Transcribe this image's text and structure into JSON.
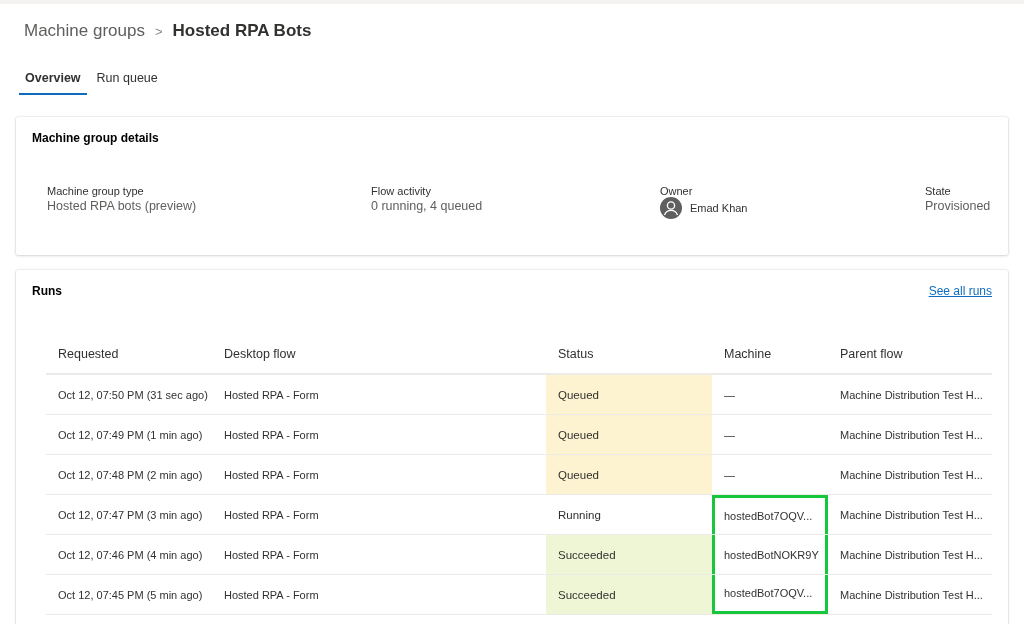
{
  "breadcrumb": {
    "parent": "Machine groups",
    "separator": ">",
    "current": "Hosted RPA Bots"
  },
  "tabs": [
    {
      "label": "Overview",
      "selected": true
    },
    {
      "label": "Run queue",
      "selected": false
    }
  ],
  "details": {
    "title": "Machine group details",
    "fields": [
      {
        "kind": "text",
        "label": "Machine group type",
        "value": "Hosted RPA bots (preview)"
      },
      {
        "kind": "text",
        "label": "Flow activity",
        "value": "0 running, 4 queued"
      },
      {
        "kind": "person",
        "label": "Owner",
        "value": "Emad Khan"
      },
      {
        "kind": "text",
        "label": "State",
        "value": "Provisioned"
      }
    ]
  },
  "runs": {
    "title": "Runs",
    "link": "See all runs",
    "columns": [
      "Requested",
      "Desktop flow",
      "Status",
      "Machine",
      "Parent flow"
    ],
    "rows": [
      {
        "requested": "Oct 12, 07:50 PM (31 sec ago)",
        "desktop_flow": "Hosted RPA - Form",
        "status": {
          "kind": "queued",
          "label": "Queued"
        },
        "machine": "—",
        "machine_highlighted": false,
        "parent_flow": "Machine Distribution Test H..."
      },
      {
        "requested": "Oct 12, 07:49 PM (1 min ago)",
        "desktop_flow": "Hosted RPA - Form",
        "status": {
          "kind": "queued",
          "label": "Queued"
        },
        "machine": "—",
        "machine_highlighted": false,
        "parent_flow": "Machine Distribution Test H..."
      },
      {
        "requested": "Oct 12, 07:48 PM (2 min ago)",
        "desktop_flow": "Hosted RPA - Form",
        "status": {
          "kind": "queued",
          "label": "Queued"
        },
        "machine": "—",
        "machine_highlighted": false,
        "parent_flow": "Machine Distribution Test H..."
      },
      {
        "requested": "Oct 12, 07:47 PM (3 min ago)",
        "desktop_flow": "Hosted RPA - Form",
        "status": {
          "kind": "running",
          "label": "Running"
        },
        "machine": "hostedBot7OQV...",
        "machine_highlighted": true,
        "parent_flow": "Machine Distribution Test H..."
      },
      {
        "requested": "Oct 12, 07:46 PM (4 min ago)",
        "desktop_flow": "Hosted RPA - Form",
        "status": {
          "kind": "succeeded",
          "label": "Succeeded"
        },
        "machine": "hostedBotNOKR9Y",
        "machine_highlighted": true,
        "parent_flow": "Machine Distribution Test H..."
      },
      {
        "requested": "Oct 12, 07:45 PM (5 min ago)",
        "desktop_flow": "Hosted RPA - Form",
        "status": {
          "kind": "succeeded",
          "label": "Succeeded"
        },
        "machine": "hostedBot7OQV...",
        "machine_highlighted": true,
        "parent_flow": "Machine Distribution Test H..."
      }
    ]
  }
}
